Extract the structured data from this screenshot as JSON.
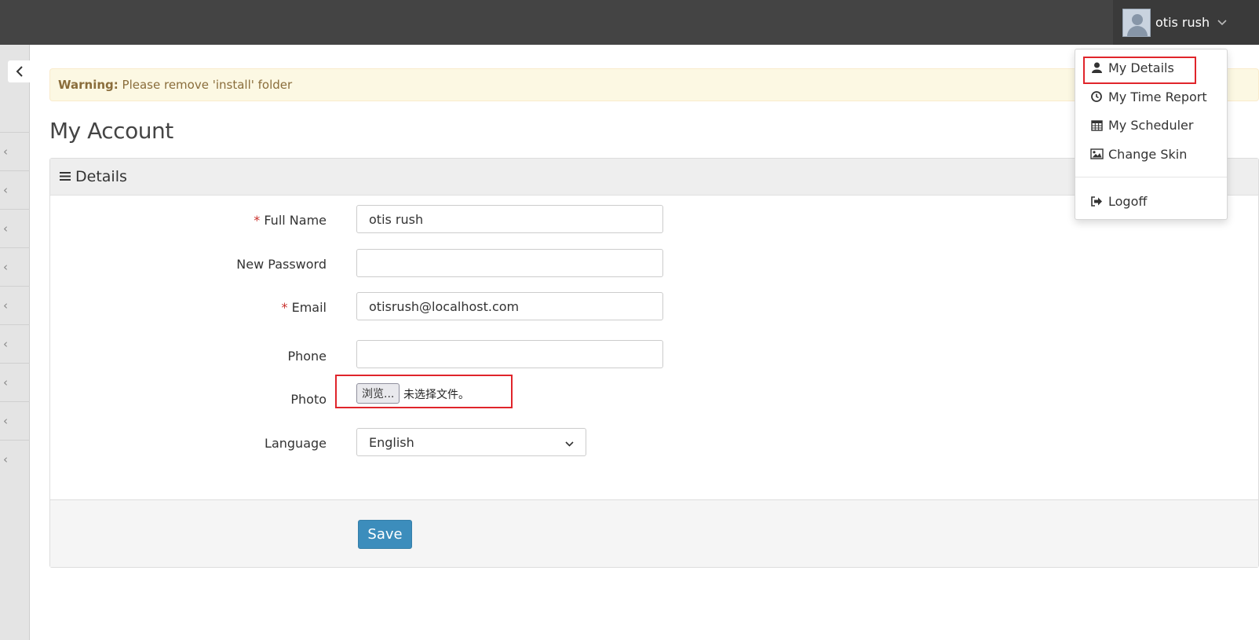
{
  "header": {
    "user_name": "otis rush"
  },
  "alert": {
    "title": "Warning:",
    "message": "Please remove 'install' folder"
  },
  "page": {
    "title": "My Account"
  },
  "panel": {
    "heading": "Details"
  },
  "form": {
    "full_name": {
      "label": "Full Name",
      "required_mark": "*",
      "value": "otis rush"
    },
    "new_password": {
      "label": "New Password",
      "value": ""
    },
    "email": {
      "label": "Email",
      "required_mark": "*",
      "value": "otisrush@localhost.com"
    },
    "phone": {
      "label": "Phone",
      "value": ""
    },
    "photo": {
      "label": "Photo",
      "button_label": "浏览...",
      "status": "未选择文件。"
    },
    "language": {
      "label": "Language",
      "selected": "English"
    },
    "save_label": "Save"
  },
  "user_dropdown": {
    "items": [
      {
        "label": "My Details",
        "icon": "user-icon"
      },
      {
        "label": "My Time Report",
        "icon": "clock-icon"
      },
      {
        "label": "My Scheduler",
        "icon": "calendar-icon"
      },
      {
        "label": "Change Skin",
        "icon": "image-icon"
      },
      {
        "label": "Logoff",
        "icon": "sign-out-icon"
      }
    ]
  },
  "colors": {
    "topbar": "#444444",
    "primary": "#3c8dbc",
    "warning_bg": "#fcf8e3",
    "warning_text": "#8a6d3b",
    "highlight_box": "#e0252b",
    "required": "#c9302c"
  }
}
